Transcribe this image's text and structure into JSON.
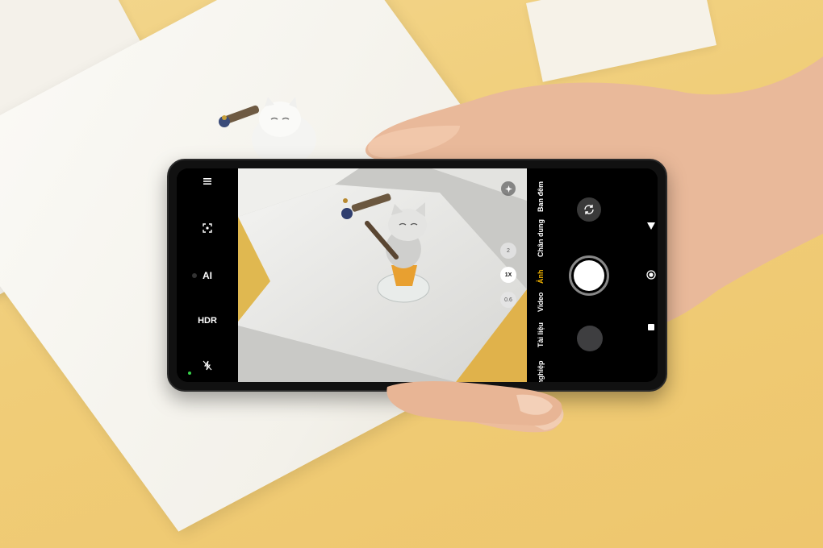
{
  "camera": {
    "left_controls": {
      "menu_icon": "menu-icon",
      "lens_icon": "scan-icon",
      "ai_label": "AI",
      "hdr_label": "HDR",
      "flash_icon": "flash-off-icon"
    },
    "viewfinder": {
      "zoom_levels": [
        "2",
        "1X",
        "0.6"
      ],
      "active_zoom": "1X",
      "top_icon": "sparkle-icon"
    },
    "modes": [
      "nghiệp",
      "Tài liệu",
      "Video",
      "Ảnh",
      "Chân dung",
      "Ban đêm"
    ],
    "active_mode": "Ảnh",
    "colors": {
      "active_mode": "#f2b300",
      "background": "#000000",
      "status_dot": "#37d04a"
    }
  },
  "nav_bar": {
    "back_icon": "triangle-back-icon",
    "home_icon": "circle-home-icon",
    "recents_icon": "square-recents-icon"
  }
}
